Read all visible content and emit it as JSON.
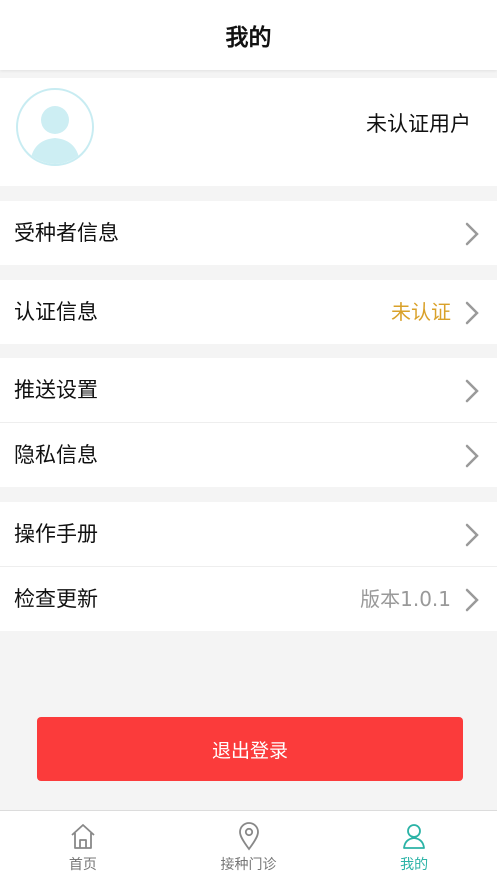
{
  "header": {
    "title": "我的"
  },
  "profile": {
    "status": "未认证用户",
    "avatar_icon": "user-silhouette-icon"
  },
  "menu": [
    {
      "label": "受种者信息",
      "value": "",
      "value_color": ""
    },
    {
      "label": "认证信息",
      "value": "未认证",
      "value_color": "#d9a12a"
    },
    {
      "label": "推送设置",
      "value": "",
      "value_color": ""
    },
    {
      "label": "隐私信息",
      "value": "",
      "value_color": ""
    },
    {
      "label": "操作手册",
      "value": "",
      "value_color": ""
    },
    {
      "label": "检查更新",
      "value": "版本1.0.1",
      "value_color": "#999999"
    }
  ],
  "logout": {
    "label": "退出登录",
    "color": "#fb3b3b"
  },
  "tabbar": {
    "items": [
      {
        "label": "首页",
        "icon": "home-icon",
        "active": false
      },
      {
        "label": "接种门诊",
        "icon": "location-pin-icon",
        "active": false
      },
      {
        "label": "我的",
        "icon": "user-icon",
        "active": true
      }
    ],
    "active_color": "#2bb3a6"
  }
}
